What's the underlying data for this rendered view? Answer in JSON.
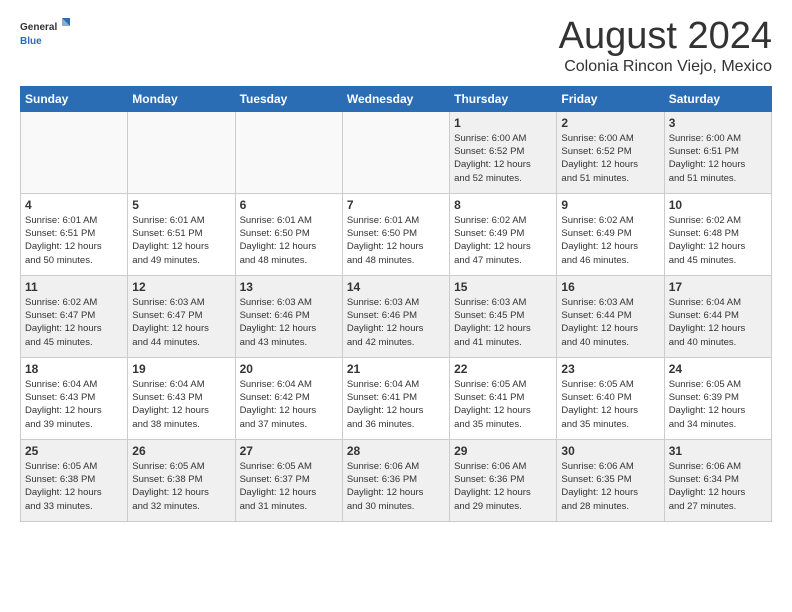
{
  "header": {
    "logo_general": "General",
    "logo_blue": "Blue",
    "title": "August 2024",
    "subtitle": "Colonia Rincon Viejo, Mexico"
  },
  "days_of_week": [
    "Sunday",
    "Monday",
    "Tuesday",
    "Wednesday",
    "Thursday",
    "Friday",
    "Saturday"
  ],
  "weeks": [
    [
      {
        "day": "",
        "info": ""
      },
      {
        "day": "",
        "info": ""
      },
      {
        "day": "",
        "info": ""
      },
      {
        "day": "",
        "info": ""
      },
      {
        "day": "1",
        "info": "Sunrise: 6:00 AM\nSunset: 6:52 PM\nDaylight: 12 hours\nand 52 minutes."
      },
      {
        "day": "2",
        "info": "Sunrise: 6:00 AM\nSunset: 6:52 PM\nDaylight: 12 hours\nand 51 minutes."
      },
      {
        "day": "3",
        "info": "Sunrise: 6:00 AM\nSunset: 6:51 PM\nDaylight: 12 hours\nand 51 minutes."
      }
    ],
    [
      {
        "day": "4",
        "info": "Sunrise: 6:01 AM\nSunset: 6:51 PM\nDaylight: 12 hours\nand 50 minutes."
      },
      {
        "day": "5",
        "info": "Sunrise: 6:01 AM\nSunset: 6:51 PM\nDaylight: 12 hours\nand 49 minutes."
      },
      {
        "day": "6",
        "info": "Sunrise: 6:01 AM\nSunset: 6:50 PM\nDaylight: 12 hours\nand 48 minutes."
      },
      {
        "day": "7",
        "info": "Sunrise: 6:01 AM\nSunset: 6:50 PM\nDaylight: 12 hours\nand 48 minutes."
      },
      {
        "day": "8",
        "info": "Sunrise: 6:02 AM\nSunset: 6:49 PM\nDaylight: 12 hours\nand 47 minutes."
      },
      {
        "day": "9",
        "info": "Sunrise: 6:02 AM\nSunset: 6:49 PM\nDaylight: 12 hours\nand 46 minutes."
      },
      {
        "day": "10",
        "info": "Sunrise: 6:02 AM\nSunset: 6:48 PM\nDaylight: 12 hours\nand 45 minutes."
      }
    ],
    [
      {
        "day": "11",
        "info": "Sunrise: 6:02 AM\nSunset: 6:47 PM\nDaylight: 12 hours\nand 45 minutes."
      },
      {
        "day": "12",
        "info": "Sunrise: 6:03 AM\nSunset: 6:47 PM\nDaylight: 12 hours\nand 44 minutes."
      },
      {
        "day": "13",
        "info": "Sunrise: 6:03 AM\nSunset: 6:46 PM\nDaylight: 12 hours\nand 43 minutes."
      },
      {
        "day": "14",
        "info": "Sunrise: 6:03 AM\nSunset: 6:46 PM\nDaylight: 12 hours\nand 42 minutes."
      },
      {
        "day": "15",
        "info": "Sunrise: 6:03 AM\nSunset: 6:45 PM\nDaylight: 12 hours\nand 41 minutes."
      },
      {
        "day": "16",
        "info": "Sunrise: 6:03 AM\nSunset: 6:44 PM\nDaylight: 12 hours\nand 40 minutes."
      },
      {
        "day": "17",
        "info": "Sunrise: 6:04 AM\nSunset: 6:44 PM\nDaylight: 12 hours\nand 40 minutes."
      }
    ],
    [
      {
        "day": "18",
        "info": "Sunrise: 6:04 AM\nSunset: 6:43 PM\nDaylight: 12 hours\nand 39 minutes."
      },
      {
        "day": "19",
        "info": "Sunrise: 6:04 AM\nSunset: 6:43 PM\nDaylight: 12 hours\nand 38 minutes."
      },
      {
        "day": "20",
        "info": "Sunrise: 6:04 AM\nSunset: 6:42 PM\nDaylight: 12 hours\nand 37 minutes."
      },
      {
        "day": "21",
        "info": "Sunrise: 6:04 AM\nSunset: 6:41 PM\nDaylight: 12 hours\nand 36 minutes."
      },
      {
        "day": "22",
        "info": "Sunrise: 6:05 AM\nSunset: 6:41 PM\nDaylight: 12 hours\nand 35 minutes."
      },
      {
        "day": "23",
        "info": "Sunrise: 6:05 AM\nSunset: 6:40 PM\nDaylight: 12 hours\nand 35 minutes."
      },
      {
        "day": "24",
        "info": "Sunrise: 6:05 AM\nSunset: 6:39 PM\nDaylight: 12 hours\nand 34 minutes."
      }
    ],
    [
      {
        "day": "25",
        "info": "Sunrise: 6:05 AM\nSunset: 6:38 PM\nDaylight: 12 hours\nand 33 minutes."
      },
      {
        "day": "26",
        "info": "Sunrise: 6:05 AM\nSunset: 6:38 PM\nDaylight: 12 hours\nand 32 minutes."
      },
      {
        "day": "27",
        "info": "Sunrise: 6:05 AM\nSunset: 6:37 PM\nDaylight: 12 hours\nand 31 minutes."
      },
      {
        "day": "28",
        "info": "Sunrise: 6:06 AM\nSunset: 6:36 PM\nDaylight: 12 hours\nand 30 minutes."
      },
      {
        "day": "29",
        "info": "Sunrise: 6:06 AM\nSunset: 6:36 PM\nDaylight: 12 hours\nand 29 minutes."
      },
      {
        "day": "30",
        "info": "Sunrise: 6:06 AM\nSunset: 6:35 PM\nDaylight: 12 hours\nand 28 minutes."
      },
      {
        "day": "31",
        "info": "Sunrise: 6:06 AM\nSunset: 6:34 PM\nDaylight: 12 hours\nand 27 minutes."
      }
    ]
  ]
}
